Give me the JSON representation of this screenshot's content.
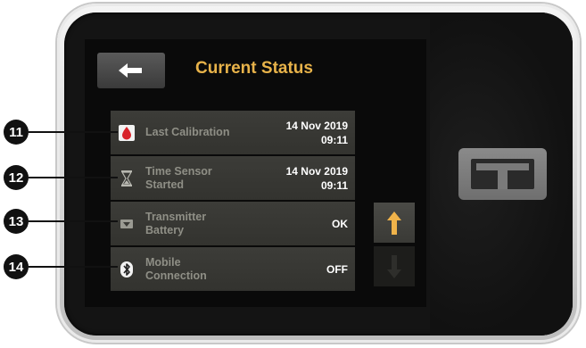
{
  "header": {
    "back_icon": "arrow-left-icon",
    "title": "Current Status"
  },
  "status_rows": [
    {
      "icon": "blood-drop-icon",
      "label": "Last Calibration",
      "value_line1": "14 Nov 2019",
      "value_line2": "09:11"
    },
    {
      "icon": "hourglass-icon",
      "label": "Time Sensor\nStarted",
      "value_line1": "14 Nov 2019",
      "value_line2": "09:11"
    },
    {
      "icon": "transmitter-icon",
      "label": "Transmitter\nBattery",
      "value_line1": "OK",
      "value_line2": ""
    },
    {
      "icon": "bluetooth-icon",
      "label": "Mobile\nConnection",
      "value_line1": "OFF",
      "value_line2": ""
    }
  ],
  "scroll": {
    "up_icon": "arrow-up-icon",
    "down_icon": "arrow-down-icon",
    "down_enabled": false
  },
  "callouts": [
    "11",
    "12",
    "13",
    "14"
  ],
  "colors": {
    "title": "#e8b34a",
    "row_bg": "#3a3a36",
    "label": "#8f8f86",
    "value": "#ffffff",
    "blood": "#d8232a",
    "scroll_up": "#f0b34a"
  },
  "logo": "t-slim-logo-icon"
}
